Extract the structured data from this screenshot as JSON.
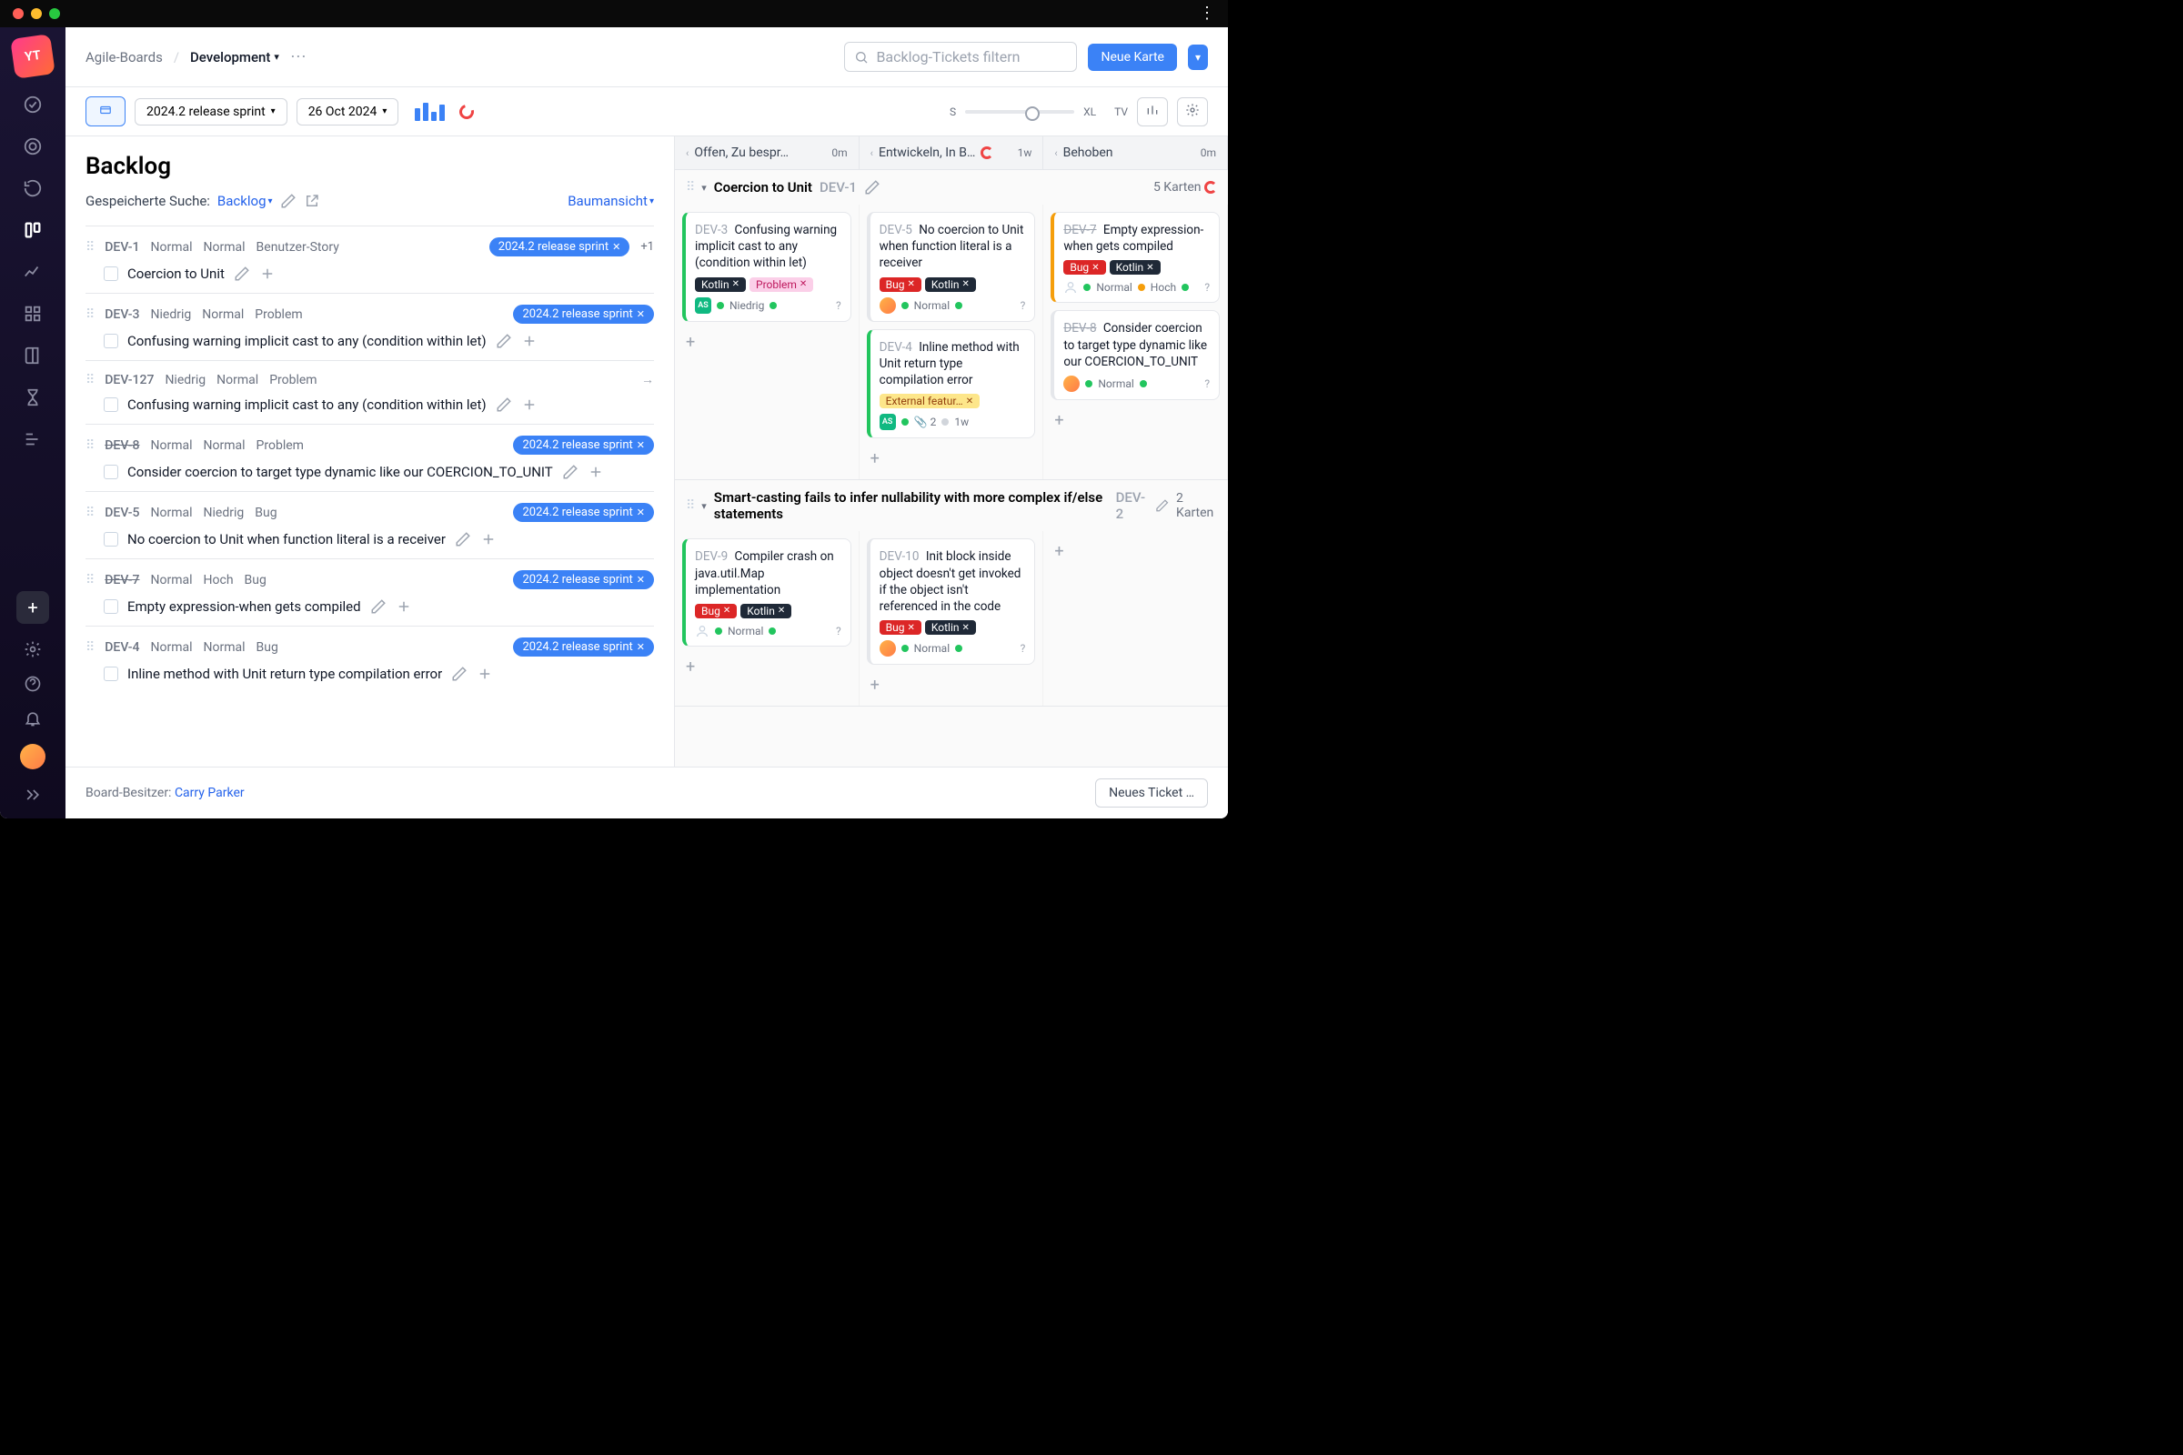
{
  "breadcrumb": {
    "parent": "Agile-Boards",
    "current": "Development"
  },
  "search_placeholder": "Backlog-Tickets filtern",
  "new_card": "Neue Karte",
  "sprint_selector": "2024.2 release sprint",
  "date_selector": "26 Oct 2024",
  "size_s": "S",
  "size_xl": "XL",
  "size_tv": "TV",
  "backlog_title": "Backlog",
  "saved_search_label": "Gespeicherte Suche:",
  "saved_search_value": "Backlog",
  "treeview": "Baumansicht",
  "sprint_tag": "2024.2 release sprint",
  "plus_one": "+1",
  "backlog_items": [
    {
      "id": "DEV-1",
      "meta": [
        "Normal",
        "Normal",
        "Benutzer-Story"
      ],
      "tag": true,
      "title": "Coercion to Unit"
    },
    {
      "id": "DEV-3",
      "meta": [
        "Niedrig",
        "Normal",
        "Problem"
      ],
      "tag": true,
      "title": "Confusing warning implicit cast to any (condition within let)"
    },
    {
      "id": "DEV-127",
      "meta": [
        "Niedrig",
        "Normal",
        "Problem"
      ],
      "arrow": true,
      "title": "Confusing warning implicit cast to any (condition within let)"
    },
    {
      "id": "DEV-8",
      "strike": true,
      "meta": [
        "Normal",
        "Normal",
        "Problem"
      ],
      "tag": true,
      "title": "Consider coercion to target type dynamic like our COERCION_TO_UNIT"
    },
    {
      "id": "DEV-5",
      "meta": [
        "Normal",
        "Niedrig",
        "Bug"
      ],
      "tag": true,
      "title": "No coercion to Unit when function literal is a receiver"
    },
    {
      "id": "DEV-7",
      "strike": true,
      "meta": [
        "Normal",
        "Hoch",
        "Bug"
      ],
      "tag": true,
      "title": "Empty expression-when gets compiled"
    },
    {
      "id": "DEV-4",
      "meta": [
        "Normal",
        "Normal",
        "Bug"
      ],
      "tag": true,
      "title": "Inline method with Unit return type compilation error"
    }
  ],
  "columns": [
    {
      "name": "Offen, Zu bespr…",
      "est": "0m"
    },
    {
      "name": "Entwickeln, In B…",
      "est": "1w",
      "pie": true
    },
    {
      "name": "Behoben",
      "est": "0m"
    }
  ],
  "swimlanes": [
    {
      "title": "Coercion to Unit",
      "id": "DEV-1",
      "count": "5 Karten",
      "pie": true,
      "cards": [
        [
          {
            "id": "DEV-3",
            "title": "Confusing warning implicit cast to any (condition within let)",
            "tags": [
              {
                "t": "kotlin",
                "l": "Kotlin"
              },
              {
                "t": "problem",
                "l": "Problem"
              }
            ],
            "av": "AS",
            "prio": "Niedrig",
            "accent": "green"
          }
        ],
        [
          {
            "id": "DEV-5",
            "title": "No coercion to Unit when function literal is a receiver",
            "tags": [
              {
                "t": "bug",
                "l": "Bug"
              },
              {
                "t": "kotlin",
                "l": "Kotlin"
              }
            ],
            "avRound": true,
            "prio": "Normal"
          },
          {
            "id": "DEV-4",
            "title": "Inline method with Unit return type compilation error",
            "tags": [
              {
                "t": "ext",
                "l": "External featur…"
              }
            ],
            "av": "AS",
            "attach": "2",
            "time": "1w",
            "accent": "green"
          }
        ],
        [
          {
            "id": "DEV-7",
            "strike": true,
            "title": "Empty expression-when gets compiled",
            "tags": [
              {
                "t": "bug",
                "l": "Bug"
              },
              {
                "t": "kotlin",
                "l": "Kotlin"
              }
            ],
            "prio": "Normal",
            "prio2": "Hoch",
            "accent": "yellow",
            "avRound": false,
            "grayAv": true
          },
          {
            "id": "DEV-8",
            "strike": true,
            "title": "Consider coercion to target type dynamic like our COERCION_TO_UNIT",
            "avRound": true,
            "prio": "Normal"
          }
        ]
      ]
    },
    {
      "title": "Smart-casting fails to infer nullability with more complex if/else statements",
      "id": "DEV-2",
      "count": "2 Karten",
      "cards": [
        [
          {
            "id": "DEV-9",
            "title": "Compiler crash on java.util.Map implementation",
            "tags": [
              {
                "t": "bug",
                "l": "Bug"
              },
              {
                "t": "kotlin",
                "l": "Kotlin"
              }
            ],
            "prio": "Normal",
            "accent": "green",
            "grayAv": true
          }
        ],
        [
          {
            "id": "DEV-10",
            "title": "Init block inside object doesn't get invoked if the object isn't referenced in the code",
            "tags": [
              {
                "t": "bug",
                "l": "Bug"
              },
              {
                "t": "kotlin",
                "l": "Kotlin"
              }
            ],
            "avRound": true,
            "prio": "Normal",
            "tagsInline": true
          }
        ],
        []
      ]
    }
  ],
  "footer": {
    "label": "Board-Besitzer:",
    "owner": "Carry Parker",
    "new_ticket": "Neues Ticket …"
  }
}
